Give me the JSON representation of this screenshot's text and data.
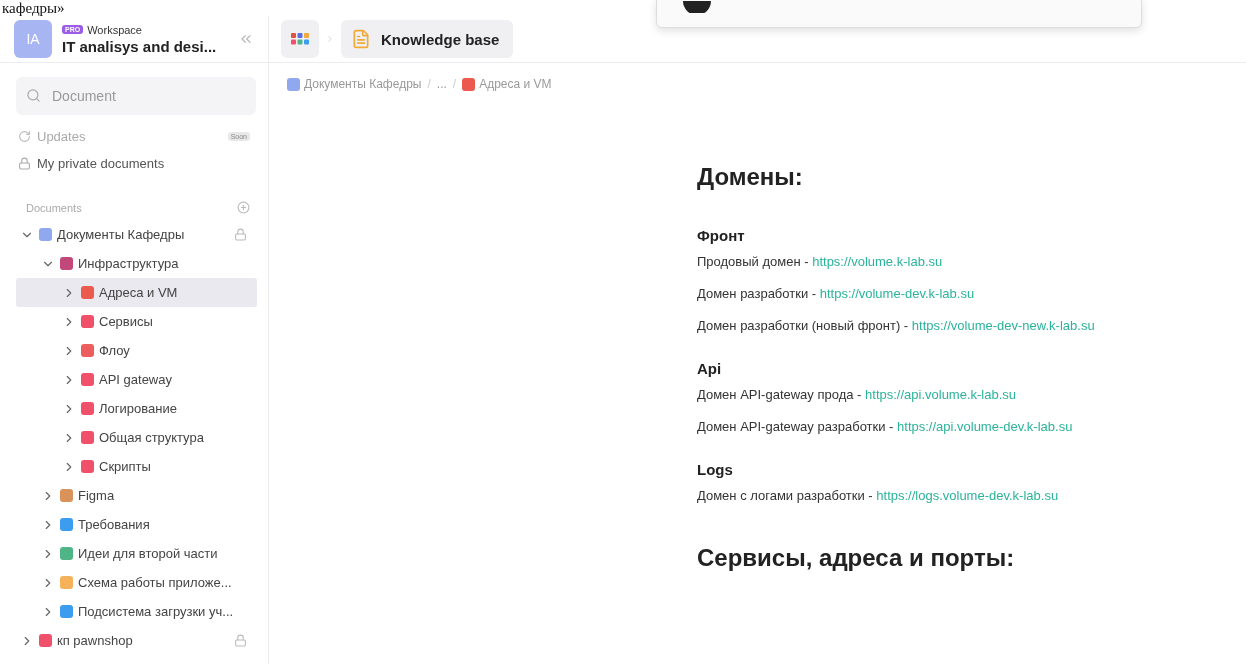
{
  "caption": "кафедры»",
  "workspace": {
    "avatar": "IA",
    "badge": "PRO",
    "label": "Workspace",
    "name": "IT analisys and desi..."
  },
  "topbar": {
    "title": "Knowledge base"
  },
  "search": {
    "placeholder": "Document"
  },
  "nav": [
    {
      "label": "Updates",
      "badge": "Soon",
      "disabled": true,
      "kind": "updates"
    },
    {
      "label": "My private documents",
      "disabled": false,
      "kind": "private"
    }
  ],
  "section": {
    "label": "Documents"
  },
  "tree": [
    {
      "label": "Документы Кафедры",
      "color": "#8fa8ee",
      "expanded": true,
      "selected": false,
      "locked": true,
      "children": [
        {
          "label": "Инфраструктура",
          "color": "#c2477a",
          "expanded": true,
          "selected": false,
          "locked": false,
          "children": [
            {
              "label": "Адреса и VM",
              "color": "#ec5a4f",
              "expanded": false,
              "selected": true,
              "locked": false
            },
            {
              "label": "Сервисы",
              "color": "#f0506a",
              "expanded": false,
              "selected": false,
              "locked": false
            },
            {
              "label": "Флоу",
              "color": "#ee5d5d",
              "expanded": false,
              "selected": false,
              "locked": false
            },
            {
              "label": "API gateway",
              "color": "#f0506a",
              "expanded": false,
              "selected": false,
              "locked": false
            },
            {
              "label": "Логирование",
              "color": "#f0506a",
              "expanded": false,
              "selected": false,
              "locked": false
            },
            {
              "label": "Общая структура",
              "color": "#f0506a",
              "expanded": false,
              "selected": false,
              "locked": false
            },
            {
              "label": "Скрипты",
              "color": "#f0506a",
              "expanded": false,
              "selected": false,
              "locked": false
            }
          ]
        },
        {
          "label": "Figma",
          "color": "#d9925a",
          "expanded": false,
          "selected": false,
          "locked": false
        },
        {
          "label": "Требования",
          "color": "#3b9cf0",
          "expanded": false,
          "selected": false,
          "locked": false
        },
        {
          "label": "Идеи для второй части",
          "color": "#4fb486",
          "expanded": false,
          "selected": false,
          "locked": false
        },
        {
          "label": "Схема работы приложе...",
          "color": "#f5b25a",
          "expanded": false,
          "selected": false,
          "locked": false
        },
        {
          "label": "Подсистема загрузки уч...",
          "color": "#3b9cf0",
          "expanded": false,
          "selected": false,
          "locked": false
        }
      ]
    },
    {
      "label": "кп pawnshop",
      "color": "#f0506a",
      "expanded": false,
      "selected": false,
      "locked": true
    }
  ],
  "breadcrumb": [
    {
      "label": "Документы Кафедры",
      "color": "#8fa8ee"
    },
    {
      "label": "...",
      "separator": "/"
    },
    {
      "label": "Адреса и VM",
      "color": "#ec5a4f",
      "separator": "/"
    }
  ],
  "document": [
    {
      "kind": "h1",
      "text": "Домены:"
    },
    {
      "kind": "h3",
      "text": "Фронт"
    },
    {
      "kind": "p",
      "text": "Продовый домен - ",
      "link": "https://volume.k-lab.su"
    },
    {
      "kind": "p",
      "text": "Домен разработки - ",
      "link": "https://volume-dev.k-lab.su"
    },
    {
      "kind": "p",
      "text": "Домен разработки (новый фронт) - ",
      "link": "https://volume-dev-new.k-lab.su"
    },
    {
      "kind": "h3",
      "text": "Api"
    },
    {
      "kind": "p",
      "text": "Домен API-gateway прода - ",
      "link": "https://api.volume.k-lab.su"
    },
    {
      "kind": "p",
      "text": "Домен API-gateway разработки - ",
      "link": "https://api.volume-dev.k-lab.su"
    },
    {
      "kind": "h3",
      "text": "Logs"
    },
    {
      "kind": "p",
      "text": "Домен с логами разработки - ",
      "link": "https://logs.volume-dev.k-lab.su"
    },
    {
      "kind": "h1",
      "text": "Сервисы, адреса и порты:"
    }
  ]
}
